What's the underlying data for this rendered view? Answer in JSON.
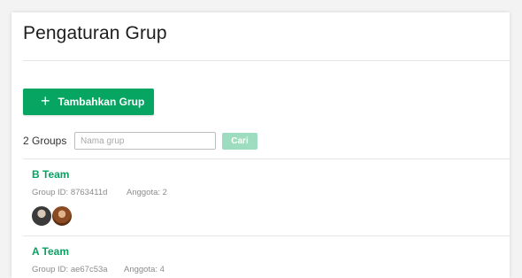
{
  "page": {
    "title": "Pengaturan Grup"
  },
  "toolbar": {
    "add_icon": "+",
    "add_label": "Tambahkan Grup"
  },
  "filter": {
    "count_label": "2 Groups",
    "search_placeholder": "Nama grup",
    "search_value": "",
    "search_button": "Cari"
  },
  "groups": [
    {
      "name": "B Team",
      "id_text": "Group ID: 8763411d",
      "members_text": "Anggota: 2"
    },
    {
      "name": "A Team",
      "id_text": "Group ID: ae67c53a",
      "members_text": "Anggota: 4"
    }
  ],
  "colors": {
    "accent": "#06a561",
    "button_disabled": "#9ddcbe"
  }
}
